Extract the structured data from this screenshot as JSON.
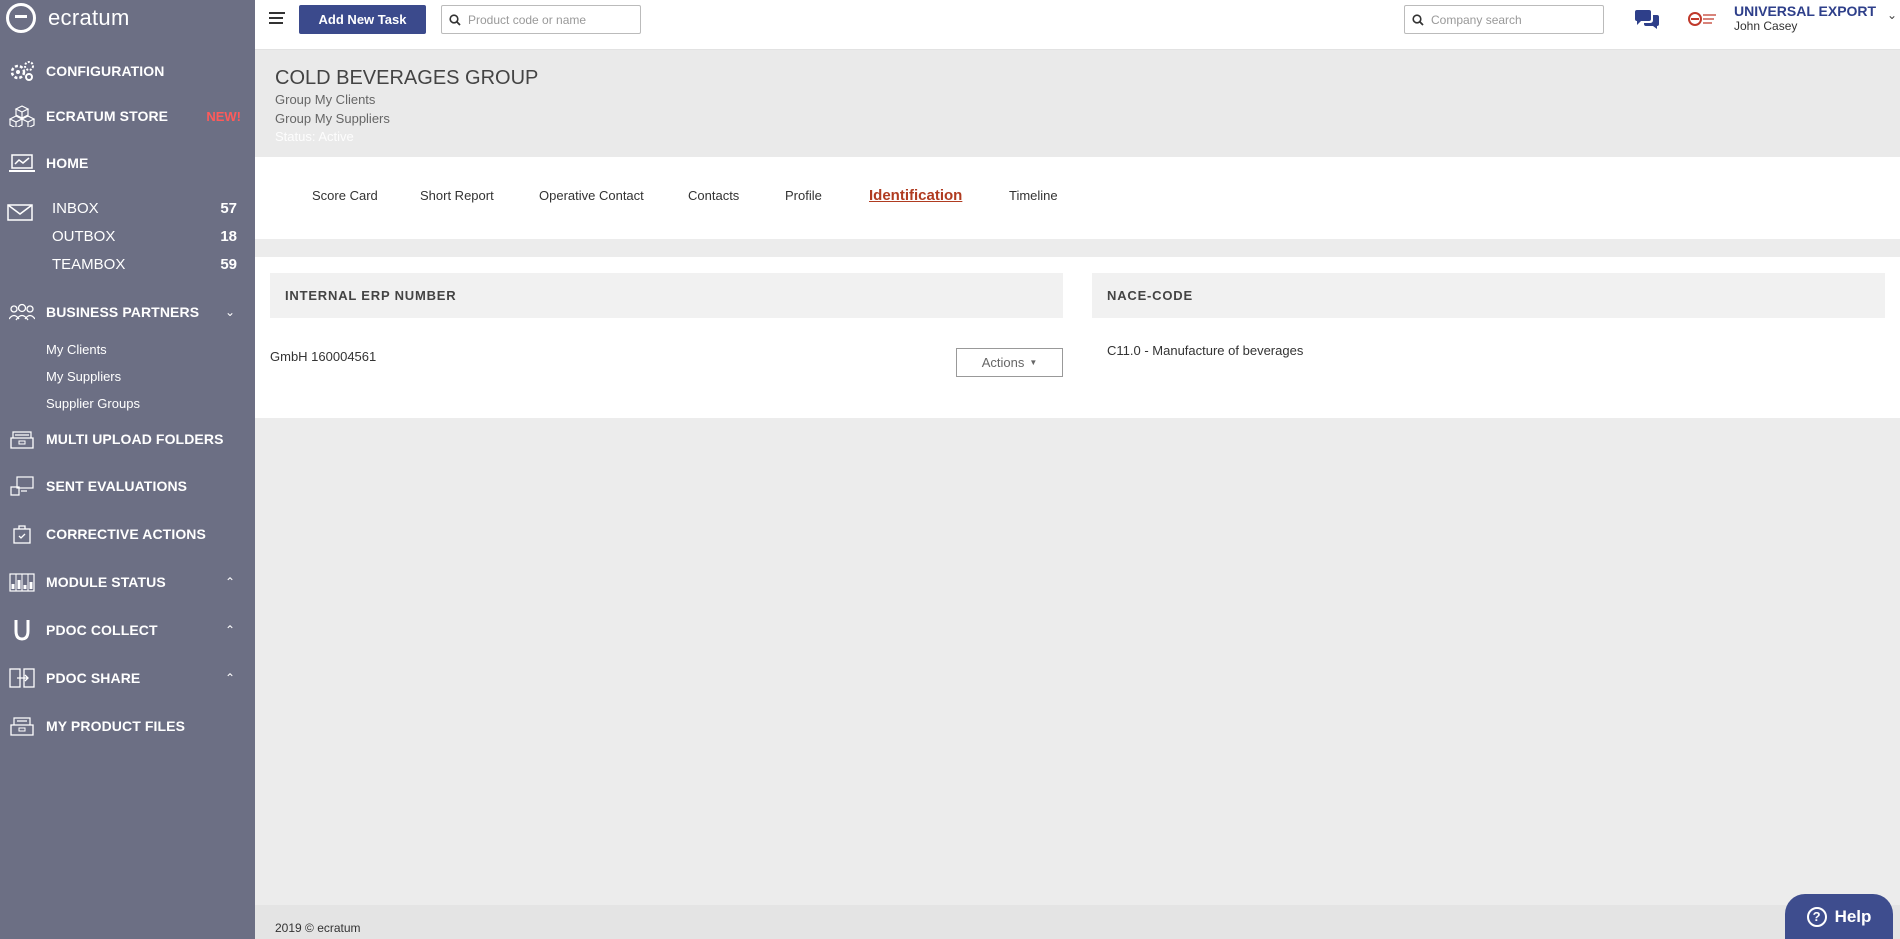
{
  "sidebar": {
    "brand": "ecratum",
    "items": {
      "configuration": "CONFIGURATION",
      "store": "ECRATUM STORE",
      "store_badge": "NEW!",
      "home": "HOME",
      "business_partners": "BUSINESS PARTNERS",
      "multi_upload": "MULTI UPLOAD FOLDERS",
      "sent_evaluations": "SENT EVALUATIONS",
      "corrective_actions": "CORRECTIVE ACTIONS",
      "module_status": "MODULE STATUS",
      "pdoc_collect": "PDOC COLLECT",
      "pdoc_share": "PDOC SHARE",
      "my_product_files": "MY PRODUCT FILES"
    },
    "mail": [
      {
        "label": "INBOX",
        "count": "57"
      },
      {
        "label": "OUTBOX",
        "count": "18"
      },
      {
        "label": "TEAMBOX",
        "count": "59"
      }
    ],
    "partners_sub": [
      "My Clients",
      "My Suppliers",
      "Supplier Groups"
    ]
  },
  "topbar": {
    "add_task": "Add New Task",
    "product_search_placeholder": "Product code or name",
    "company_search_placeholder": "Company search",
    "company": "UNIVERSAL EXPORT",
    "user": "John Casey"
  },
  "header": {
    "title": "COLD BEVERAGES GROUP",
    "sub1": "Group My Clients",
    "sub2": "Group My Suppliers",
    "status": "Status: Active"
  },
  "tabs": [
    "Score Card",
    "Short Report",
    "Operative Contact",
    "Contacts",
    "Profile",
    "Identification",
    "Timeline"
  ],
  "content": {
    "erp_head": "INTERNAL ERP NUMBER",
    "erp_value": "GmbH 160004561",
    "actions": "Actions",
    "nace_head": "NACE-CODE",
    "nace_value": "C11.0 - Manufacture of beverages"
  },
  "footer": {
    "text": "2019 © ecratum",
    "help": "Help"
  },
  "colors": {
    "sidebar": "#6c6f84",
    "accent": "#3b4a8c",
    "active_tab": "#b03b20",
    "badge": "#ff5a5a"
  }
}
